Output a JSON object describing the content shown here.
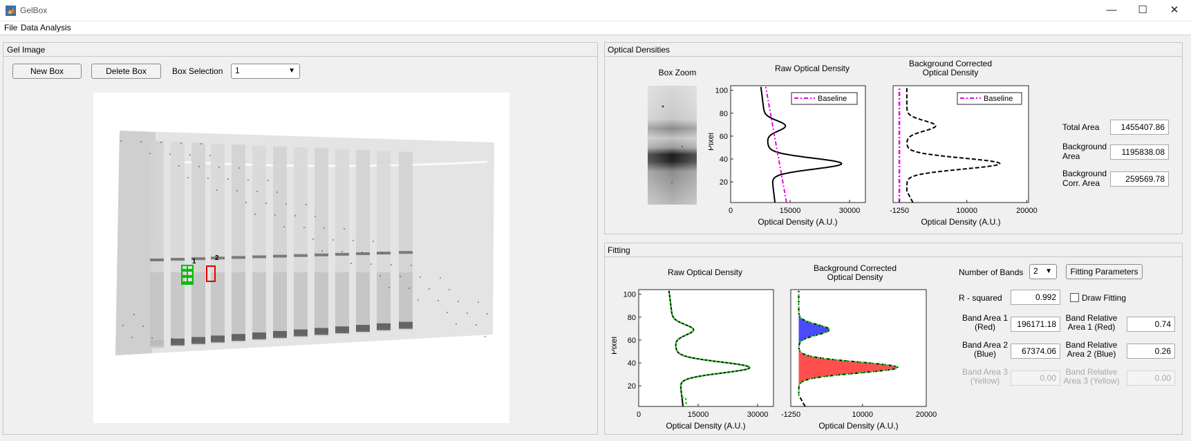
{
  "window": {
    "title": "GelBox",
    "controls": [
      "—",
      "☐",
      "✕"
    ]
  },
  "menu": [
    "File",
    "Data Analysis"
  ],
  "gel_panel": {
    "title": "Gel Image",
    "new_box": "New Box",
    "delete_box": "Delete Box",
    "box_selection_label": "Box Selection",
    "box_selection_value": "1",
    "box_labels": [
      "1",
      "2"
    ]
  },
  "od_panel": {
    "title": "Optical Densities",
    "box_zoom_title": "Box Zoom",
    "raw_title": "Raw Optical Density",
    "bc_title": [
      "Background Corrected",
      "Optical Density"
    ],
    "legend_label": "Baseline",
    "ylabel": "Pixel",
    "xlabel": "Optical Density (A.U.)",
    "raw_yticks": [
      "100",
      "80",
      "60",
      "40",
      "20"
    ],
    "raw_xticks": [
      "0",
      "15000",
      "30000"
    ],
    "bc_xticks": [
      "-1250",
      "10000",
      "20000"
    ],
    "total_area_label": "Total Area",
    "total_area": "1455407.86",
    "background_area_label": [
      "Background",
      "Area"
    ],
    "background_area": "1195838.08",
    "corr_area_label": [
      "Background",
      "Corr. Area"
    ],
    "corr_area": "259569.78"
  },
  "fit_panel": {
    "title": "Fitting",
    "raw_title": "Raw Optical Density",
    "bc_title": [
      "Background Corrected",
      "Optical Density"
    ],
    "ylabel": "Pixel",
    "xlabel": "Optical Density (A.U.)",
    "yticks": [
      "100",
      "80",
      "60",
      "40",
      "20"
    ],
    "raw_xticks": [
      "0",
      "15000",
      "30000"
    ],
    "bc_xticks": [
      "-1250",
      "10000",
      "20000"
    ],
    "num_bands_label": "Number of Bands",
    "num_bands": "2",
    "fitting_params": "Fitting Parameters",
    "rsq_label": "R - squared",
    "rsq": "0.992",
    "draw_fitting": "Draw Fitting",
    "band1_label": [
      "Band Area 1",
      "(Red)"
    ],
    "band1": "196171.18",
    "band2_label": [
      "Band Area 2",
      "(Blue)"
    ],
    "band2": "67374.06",
    "band3_label": [
      "Band Area 3",
      "(Yellow)"
    ],
    "band3": "0.00",
    "rel1_label": [
      "Band Relative",
      "Area 1 (Red)"
    ],
    "rel1": "0.74",
    "rel2_label": [
      "Band Relative",
      "Area 2 (Blue)"
    ],
    "rel2": "0.26",
    "rel3_label": [
      "Band Relative",
      "Area 3 (Yellow)"
    ],
    "rel3": "0.00"
  },
  "colors": {
    "baseline": "#e600e6",
    "fit": "#22cc22",
    "band_red": "#ff5050",
    "band_blue": "#4a4aff",
    "box_selected": "#00c000",
    "box_other": "#e00000"
  }
}
